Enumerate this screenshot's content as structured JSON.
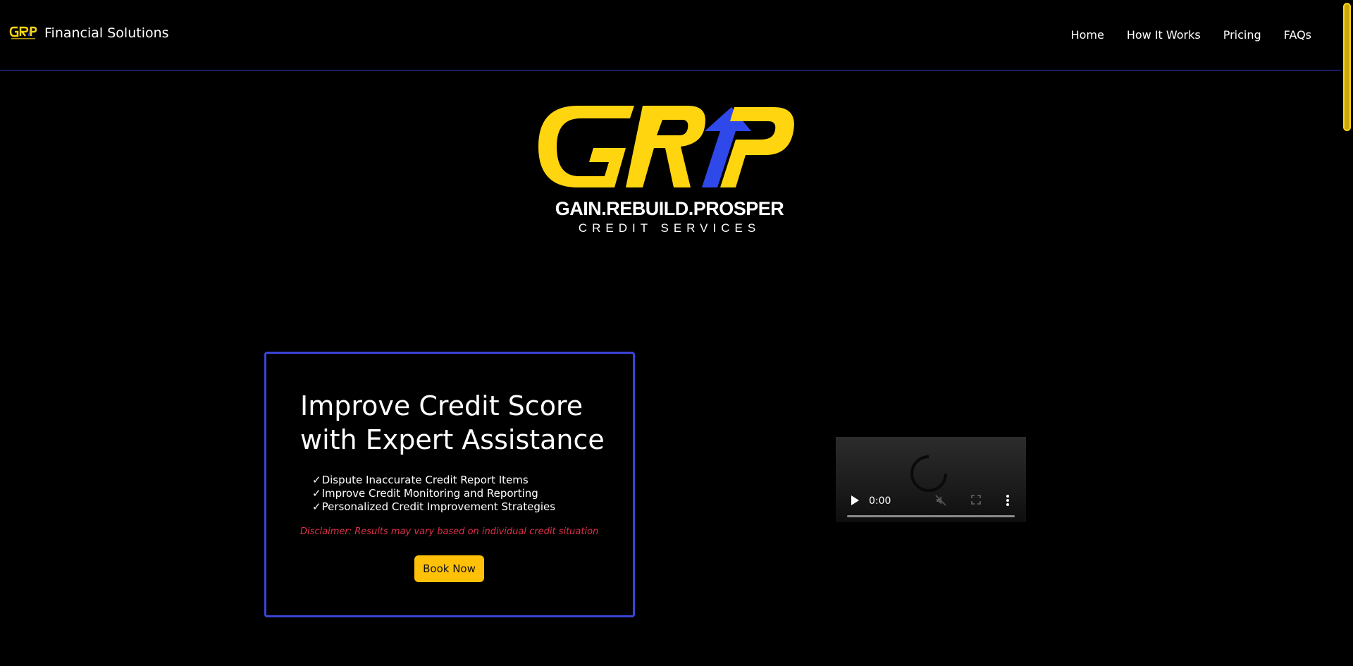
{
  "navbar": {
    "brand_name": "Financial Solutions",
    "links": [
      "Home",
      "How It Works",
      "Pricing",
      "FAQs"
    ]
  },
  "hero": {
    "logo_alt": "GRIP",
    "tagline": "GAIN.REBUILD.PROSPER",
    "subtag": "CREDIT SERVICES"
  },
  "card": {
    "title": "Improve Credit Score with Expert Assistance",
    "features": [
      "Dispute Inaccurate Credit Report Items",
      "Improve Credit Monitoring and Reporting",
      "Personalized Credit Improvement Strategies"
    ],
    "check": "✓",
    "disclaimer": "Disclaimer: Results may vary based on individual credit situation",
    "button_label": "Book Now"
  },
  "video": {
    "time": "0:00"
  },
  "colors": {
    "accent_yellow": "#ffd50f",
    "accent_blue": "#2f48ea",
    "border_blue": "#3a44d6",
    "button_yellow": "#ffc107",
    "disclaimer_red": "#e0304a"
  },
  "icons": {
    "play": "play-icon",
    "mute": "mute-icon",
    "fullscreen": "fullscreen-icon",
    "more": "more-icon"
  }
}
